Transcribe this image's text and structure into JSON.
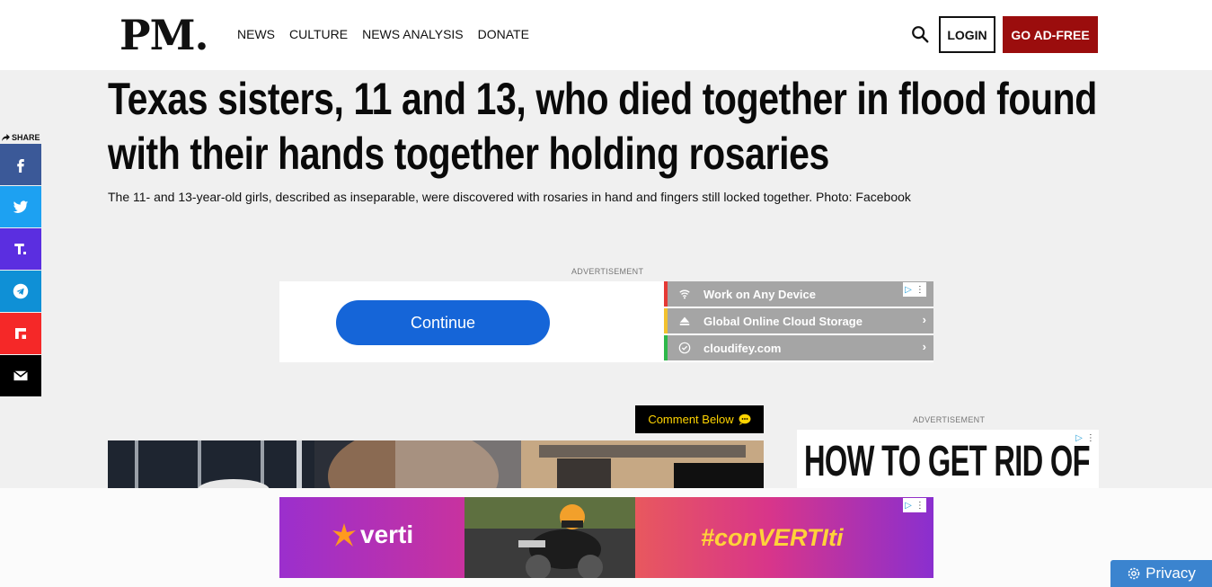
{
  "header": {
    "logo": "PM.",
    "nav": [
      "NEWS",
      "CULTURE",
      "NEWS ANALYSIS",
      "DONATE"
    ],
    "login_label": "LOGIN",
    "adfree_label": "GO AD-FREE",
    "search_icon": "search-icon"
  },
  "article": {
    "headline_line1": "Texas sisters, 11 and 13, who died together in flood found",
    "headline_line2": "with their hands together holding rosaries",
    "subhead": "The 11- and 13-year-old girls, described as inseparable, were discovered with rosaries in hand and fingers still locked together. Photo: Facebook",
    "comment_label": "Comment Below"
  },
  "share": {
    "label": "SHARE",
    "buttons": [
      {
        "name": "facebook",
        "color": "#3b5998"
      },
      {
        "name": "twitter",
        "color": "#1da1f2"
      },
      {
        "name": "truth-social",
        "color": "#5b2ee0"
      },
      {
        "name": "telegram",
        "color": "#0f90d6"
      },
      {
        "name": "flipboard",
        "color": "#f52828"
      },
      {
        "name": "email",
        "color": "#000000"
      }
    ]
  },
  "ads": {
    "label": "ADVERTISEMENT",
    "top": {
      "button": "Continue",
      "rows": [
        {
          "text": "Work on Any Device",
          "bar": "#e53935",
          "icon": "wifi-icon"
        },
        {
          "text": "Global Online Cloud Storage",
          "bar": "#f2c12e",
          "icon": "eject-icon"
        },
        {
          "text": "cloudifey.com",
          "bar": "#2eb84a",
          "icon": "check-circle-icon"
        }
      ]
    },
    "right": {
      "text": "HOW TO GET RID OF"
    },
    "bottom": {
      "brand": "verti",
      "slogan": "#conVERTIti"
    }
  },
  "privacy": {
    "label": "Privacy"
  }
}
